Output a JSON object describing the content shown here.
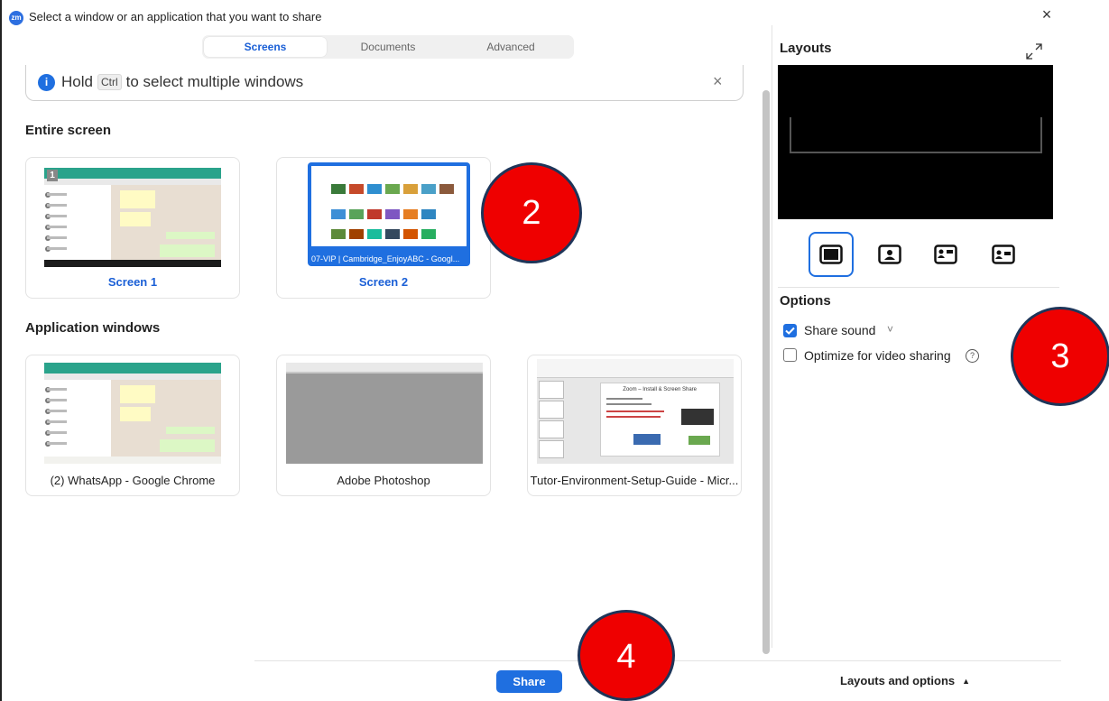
{
  "window": {
    "app_icon": "zm",
    "title": "Select a window or an application that you want to share",
    "close_symbol": "×"
  },
  "tabs": [
    {
      "label": "Screens",
      "active": true
    },
    {
      "label": "Documents",
      "active": false
    },
    {
      "label": "Advanced",
      "active": false
    }
  ],
  "hint": {
    "info_icon": "i",
    "prefix": "Hold",
    "key": "Ctrl",
    "suffix": "to select multiple windows",
    "close_symbol": "×"
  },
  "entire_screen": {
    "title": "Entire screen",
    "items": [
      {
        "label": "Screen 1",
        "badge": "1",
        "selected": false
      },
      {
        "label": "Screen 2",
        "caption": "07-VIP | Cambridge_EnjoyABC - Googl...",
        "selected": true
      }
    ]
  },
  "application_windows": {
    "title": "Application windows",
    "items": [
      {
        "label": "(2) WhatsApp - Google Chrome"
      },
      {
        "label": "Adobe Photoshop"
      },
      {
        "label": "Tutor-Environment-Setup-Guide - Micr..."
      }
    ]
  },
  "layouts": {
    "title": "Layouts",
    "expand_icon": "expand-icon",
    "options": [
      "layout-screen-only",
      "layout-person-center",
      "layout-person-left",
      "layout-person-right"
    ],
    "selected": 0
  },
  "options": {
    "title": "Options",
    "share_sound": {
      "label": "Share sound",
      "checked": true,
      "chevron": "˅"
    },
    "optimize_video": {
      "label": "Optimize for video sharing",
      "checked": false,
      "help": "?"
    }
  },
  "footer": {
    "share_label": "Share",
    "layouts_options_label": "Layouts and options",
    "layouts_options_arrow": "▲"
  },
  "markers": [
    "2",
    "3",
    "4"
  ],
  "colors": {
    "accent": "#1f6fe0",
    "marker_fill": "#ef0000",
    "marker_border": "#1e3559"
  },
  "slide_preview": {
    "title": "Zoom – Install & Screen Share"
  }
}
